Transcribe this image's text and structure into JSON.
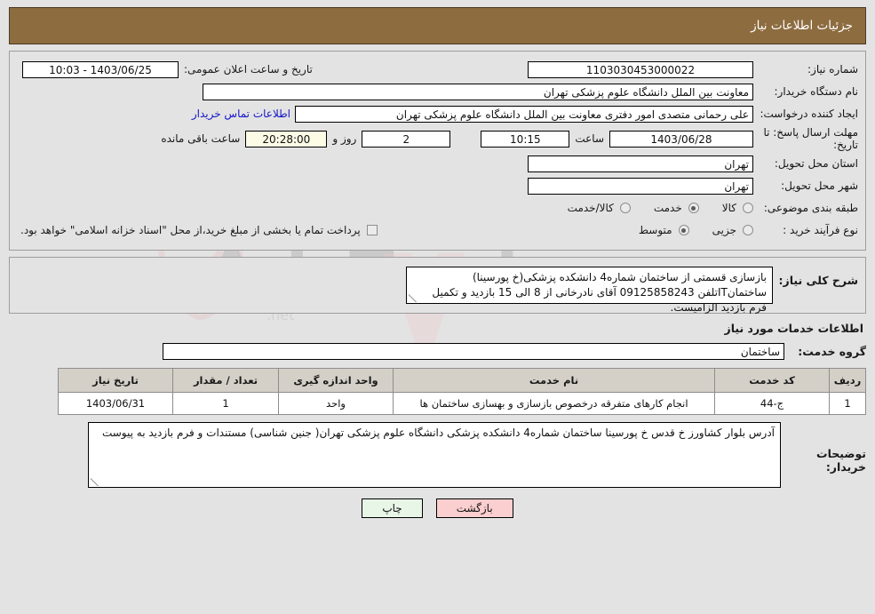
{
  "header": {
    "title": "جزئیات اطلاعات نیاز"
  },
  "colors": {
    "header_bg": "#8d6c40",
    "page_bg": "#e3e3e3",
    "link": "#1414c8",
    "table_header_bg": "#d4d0c8",
    "back_button_bg": "#fbcfcf",
    "print_button_bg": "#e8f6e8",
    "countdown_field_bg": "#fbfbe6"
  },
  "watermark": {
    "text": "AriaTender",
    "suffix": ".net"
  },
  "form": {
    "need_number": {
      "label": "شماره نیاز:",
      "value": "1103030453000022"
    },
    "announce": {
      "label": "تاریخ و ساعت اعلان عمومی:",
      "value": "10:03 - 1403/06/25"
    },
    "buyer_org": {
      "label": "نام دستگاه خریدار:",
      "value": "معاونت بین الملل دانشگاه علوم پزشکی تهران"
    },
    "creator": {
      "label": "ایجاد کننده درخواست:",
      "value": "علی رحمانی متصدی امور دفتری معاونت بین الملل دانشگاه علوم پزشکی تهران",
      "contact_link": "اطلاعات تماس خریدار"
    },
    "deadline": {
      "label": "مهلت ارسال پاسخ: تا تاریخ:",
      "date": "1403/06/28",
      "time_label": "ساعت",
      "time": "10:15",
      "days": "2",
      "days_suffix": "روز و",
      "countdown": "20:28:00",
      "countdown_suffix": "ساعت باقی مانده"
    },
    "province": {
      "label": "استان محل تحویل:",
      "value": "تهران"
    },
    "city": {
      "label": "شهر محل تحویل:",
      "value": "تهران"
    },
    "category": {
      "label": "طبقه بندی موضوعی:",
      "options": [
        {
          "label": "کالا",
          "selected": false
        },
        {
          "label": "خدمت",
          "selected": true
        },
        {
          "label": "کالا/خدمت",
          "selected": false
        }
      ]
    },
    "purchase_type": {
      "label": "نوع فرآیند خرید :",
      "options": [
        {
          "label": "جزیی",
          "selected": false
        },
        {
          "label": "متوسط",
          "selected": true
        }
      ],
      "checkbox": {
        "label": "پرداخت تمام یا بخشی از مبلغ خرید،از محل \"اسناد خزانه اسلامی\" خواهد بود.",
        "checked": false
      }
    }
  },
  "need_description": {
    "label": "شرح کلی نیاز:",
    "value": "بازسازی قسمتی از ساختمان شماره4 دانشکده پزشکی(خ پورسینا) ساختمانITتلفن 09125858243 آقای نادرخانی از 8 الی 15 بازدید و تکمیل فرم بازدید الزامیست."
  },
  "services_section": {
    "title": "اطلاعات خدمات مورد نیاز",
    "service_group": {
      "label": "گروه خدمت:",
      "value": "ساختمان"
    },
    "table": {
      "columns": [
        "ردیف",
        "کد خدمت",
        "نام خدمت",
        "واحد اندازه گیری",
        "تعداد / مقدار",
        "تاریخ نیاز"
      ],
      "rows": [
        {
          "row_no": "1",
          "service_code": "ج-44",
          "service_name": "انجام کارهای متفرقه درخصوص بازسازی و بهسازی ساختمان ها",
          "unit": "واحد",
          "quantity": "1",
          "need_date": "1403/06/31"
        }
      ]
    }
  },
  "buyer_notes": {
    "label": "توضیحات خریدار:",
    "value": "آدرس بلوار کشاورز خ قدس خ پورسینا ساختمان شماره4 دانشکده پزشکی دانشگاه علوم پزشکی تهران( جنین شناسی) مستندات و فرم بازدید به پیوست"
  },
  "footer": {
    "print_label": "چاپ",
    "back_label": "بازگشت"
  }
}
